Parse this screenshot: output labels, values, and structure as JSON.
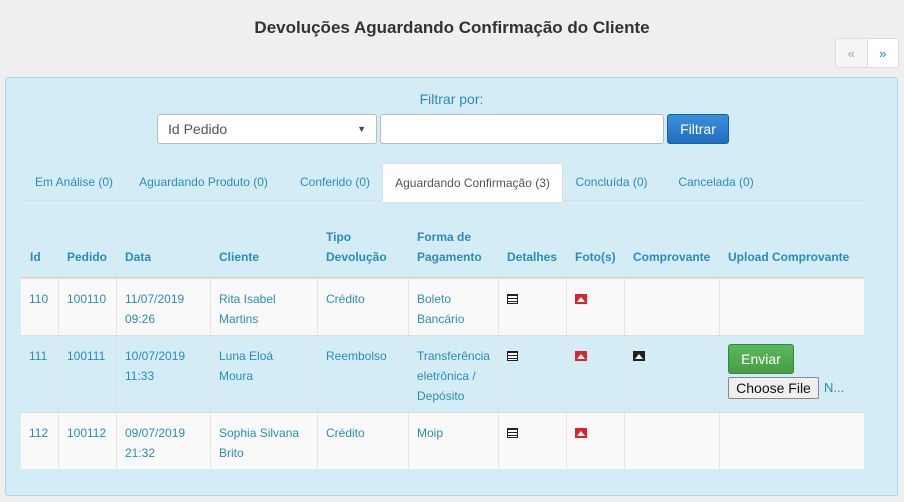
{
  "title": "Devoluções Aguardando Confirmação do Cliente",
  "pager": {
    "prev": "«",
    "next": "»"
  },
  "filter": {
    "label": "Filtrar por:",
    "select_value": "Id Pedido",
    "input_value": "",
    "button": "Filtrar"
  },
  "tabs": [
    {
      "label": "Em Análise (0)"
    },
    {
      "label": "Aguardando Produto (0)"
    },
    {
      "label": "Conferido (0)"
    },
    {
      "label": "Aguardando Confirmação (3)"
    },
    {
      "label": "Concluída (0)"
    },
    {
      "label": "Cancelada (0)"
    }
  ],
  "columns": [
    "Id",
    "Pedido",
    "Data",
    "Cliente",
    "Tipo Devolução",
    "Forma de Pagamento",
    "Detalhes",
    "Foto(s)",
    "Comprovante",
    "Upload Comprovante"
  ],
  "rows": [
    {
      "id": "110",
      "pedido": "100110",
      "data": "11/07/2019 09:26",
      "cliente": "Rita Isabel Martins",
      "tipo": "Crédito",
      "pagamento": "Boleto Bancário"
    },
    {
      "id": "111",
      "pedido": "100111",
      "data": "10/07/2019 11:33",
      "cliente": "Luna Eloá Moura",
      "tipo": "Reembolso",
      "pagamento": "Transferência eletrônica / Depósito"
    },
    {
      "id": "112",
      "pedido": "100112",
      "data": "09/07/2019 21:32",
      "cliente": "Sophia Silvana Brito",
      "tipo": "Crédito",
      "pagamento": "Moip"
    }
  ],
  "upload": {
    "send_button": "Enviar",
    "choose_file": "Choose File",
    "no_file": "N..."
  },
  "icons": {
    "details": "document-list-icon",
    "photos": "photo-icon",
    "receipt": "image-icon"
  },
  "colors": {
    "link": "#2a8db3",
    "panel": "#d4ecf6",
    "primary": "#1f6fc0",
    "success": "#449d44",
    "photo_icon": "#d9242b"
  }
}
